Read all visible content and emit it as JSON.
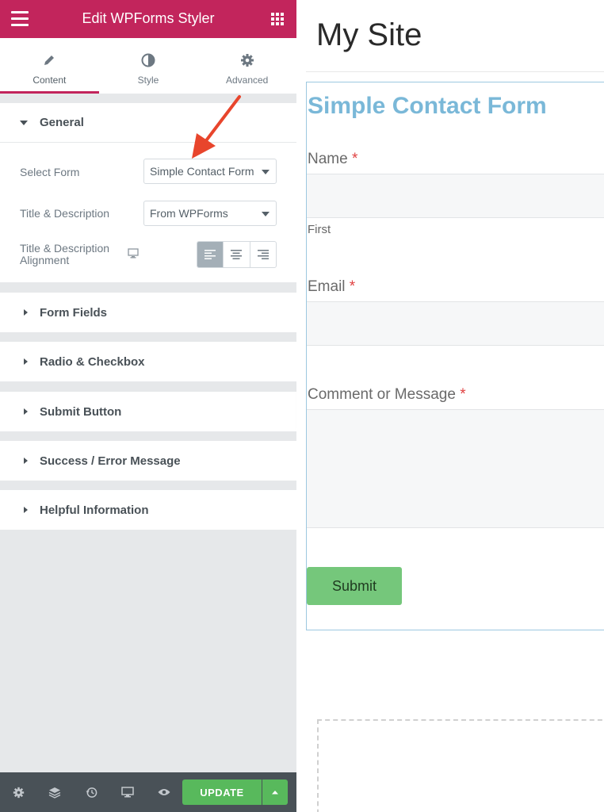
{
  "editor": {
    "header_title": "Edit WPForms Styler",
    "tabs": [
      {
        "label": "Content",
        "icon": "pencil-icon",
        "active": true
      },
      {
        "label": "Style",
        "icon": "half-circle-icon",
        "active": false
      },
      {
        "label": "Advanced",
        "icon": "gear-icon",
        "active": false
      }
    ],
    "general": {
      "title": "General",
      "select_form_label": "Select Form",
      "select_form_value": "Simple Contact Form",
      "title_desc_label": "Title & Description",
      "title_desc_value": "From WPForms",
      "alignment_label_line1": "Title & Description",
      "alignment_label_line2": "Alignment",
      "alignment_options": [
        "left",
        "center",
        "right"
      ],
      "alignment_selected": "left"
    },
    "sections": [
      {
        "title": "Form Fields"
      },
      {
        "title": "Radio & Checkbox"
      },
      {
        "title": "Submit Button"
      },
      {
        "title": "Success / Error Message"
      },
      {
        "title": "Helpful Information"
      }
    ],
    "footer": {
      "update_label": "UPDATE"
    }
  },
  "preview": {
    "site_title": "My Site",
    "form": {
      "title": "Simple Contact Form",
      "name_label": "Name",
      "name_sublabel": "First",
      "email_label": "Email",
      "message_label": "Comment or Message",
      "required_mark": "*",
      "submit_label": "Submit"
    }
  },
  "colors": {
    "brand": "#c2255c",
    "update_green": "#58b95c",
    "form_title_blue": "#7ab8d8",
    "required_red": "#e04242",
    "annotation_arrow": "#e8452c"
  }
}
